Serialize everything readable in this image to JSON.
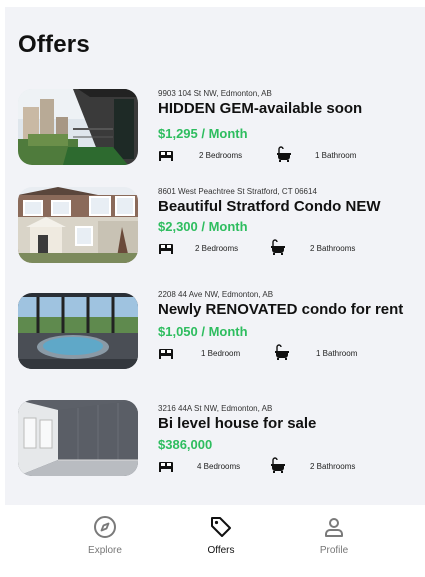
{
  "header": {
    "title": "Offers"
  },
  "offers": [
    {
      "address": "9903 104 St NW, Edmonton, AB",
      "name": "HIDDEN GEM-available soon",
      "price": "$1,295 / Month",
      "bedrooms": "2 Bedrooms",
      "bathrooms": "1 Bathroom",
      "photo": "balcony-city-view"
    },
    {
      "address": "8601 West Peachtree St Stratford, CT 06614",
      "name": "Beautiful Stratford Condo NEW",
      "price": "$2,300 / Month",
      "bedrooms": "2 Bedrooms",
      "bathrooms": "2 Bathrooms",
      "photo": "townhouse-exterior"
    },
    {
      "address": "2208 44 Ave NW, Edmonton, AB",
      "name": "Newly RENOVATED condo for rent",
      "price": "$1,050 / Month",
      "bedrooms": "1 Bedroom",
      "bathrooms": "1 Bathroom",
      "photo": "hot-tub-room"
    },
    {
      "address": "3216 44A St NW, Edmonton, AB",
      "name": "Bi level house for sale",
      "price": "$386,000",
      "bedrooms": "4 Bedrooms",
      "bathrooms": "2 Bathrooms",
      "photo": "empty-grey-room"
    }
  ],
  "nav": {
    "items": [
      {
        "label": "Explore",
        "icon": "compass-icon",
        "active": false
      },
      {
        "label": "Offers",
        "icon": "tag-icon",
        "active": true
      },
      {
        "label": "Profile",
        "icon": "user-icon",
        "active": false
      }
    ]
  },
  "colors": {
    "price": "#2ebd5f",
    "background": "#f2f3f7",
    "navbar": "#ffffff",
    "nav_inactive": "#777777"
  }
}
